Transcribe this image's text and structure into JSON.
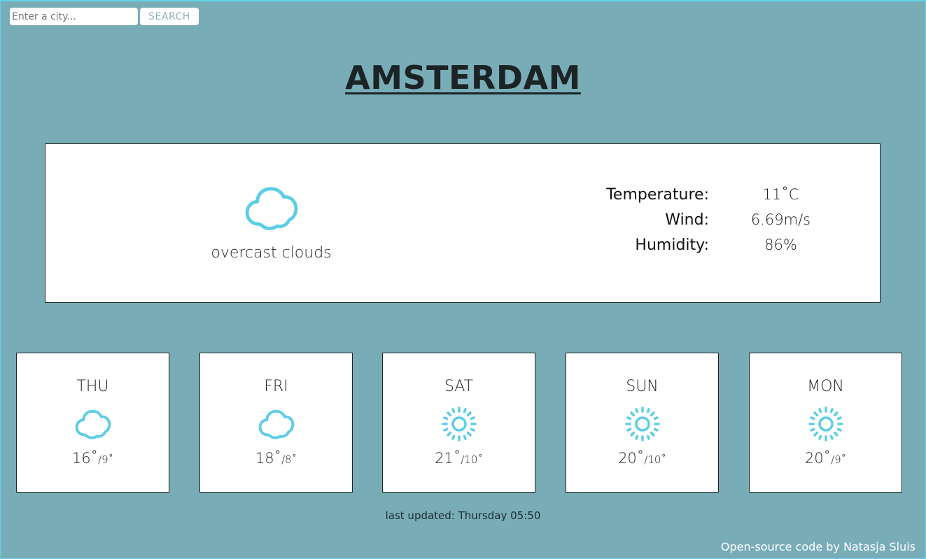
{
  "search": {
    "placeholder": "Enter a city...",
    "button_label": "SEARCH"
  },
  "city": "AMSTERDAM",
  "current": {
    "icon": "cloud-icon",
    "description": "overcast clouds",
    "stats": [
      {
        "label": "Temperature:",
        "value": "11˚C"
      },
      {
        "label": "Wind:",
        "value": "6.69m/s"
      },
      {
        "label": "Humidity:",
        "value": "86%"
      }
    ]
  },
  "forecast": [
    {
      "day": "THU",
      "icon": "cloud-icon",
      "high": "16˚",
      "low": "/9˚"
    },
    {
      "day": "FRI",
      "icon": "cloud-icon",
      "high": "18˚",
      "low": "/8˚"
    },
    {
      "day": "SAT",
      "icon": "sun-icon",
      "high": "21˚",
      "low": "/10˚"
    },
    {
      "day": "SUN",
      "icon": "sun-icon",
      "high": "20˚",
      "low": "/10˚"
    },
    {
      "day": "MON",
      "icon": "sun-icon",
      "high": "20˚",
      "low": "/9˚"
    }
  ],
  "last_updated": "last updated: Thursday 05:50",
  "credit": "Open-source code by Natasja Sluis",
  "colors": {
    "background": "#78adb8",
    "icon": "#5dcde6",
    "card": "#ffffff"
  }
}
